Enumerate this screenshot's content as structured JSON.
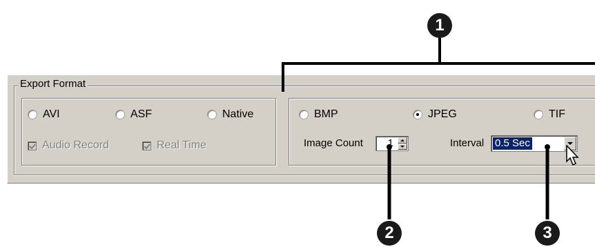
{
  "group_title": "Export Format",
  "video_formats": [
    {
      "label": "AVI",
      "checked": false
    },
    {
      "label": "ASF",
      "checked": false
    },
    {
      "label": "Native",
      "checked": false
    }
  ],
  "checkboxes": [
    {
      "label": "Audio Record",
      "checked": true,
      "disabled": true
    },
    {
      "label": "Real Time",
      "checked": true,
      "disabled": true
    }
  ],
  "image_formats": [
    {
      "label": "BMP",
      "checked": false
    },
    {
      "label": "JPEG",
      "checked": true
    },
    {
      "label": "TIF",
      "checked": false
    }
  ],
  "image_count": {
    "label": "Image Count",
    "value": "1"
  },
  "interval": {
    "label": "Interval",
    "value": "0.5 Sec"
  },
  "callouts": [
    "1",
    "2",
    "3"
  ]
}
